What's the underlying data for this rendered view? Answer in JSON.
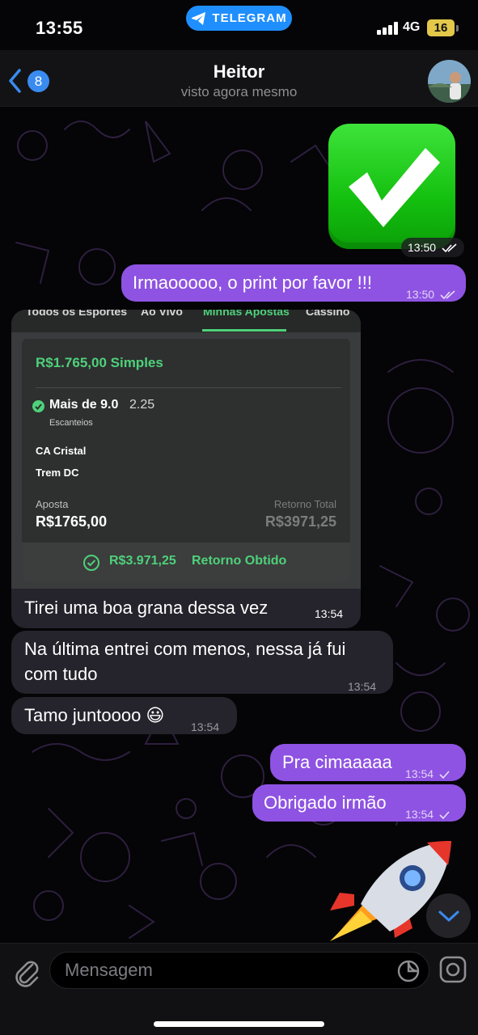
{
  "status_bar": {
    "time": "13:55",
    "app_pill": "TELEGRAM",
    "network": "4G",
    "battery": "16"
  },
  "header": {
    "back_badge": "8",
    "title": "Heitor",
    "subtitle": "visto agora mesmo"
  },
  "messages": {
    "emoji_time": "13:50",
    "m1": {
      "text": "Irmaooooo, o print por favor !!!",
      "time": "13:50"
    },
    "bet": {
      "tabs": [
        "Todos os Esportes",
        "Ao Vivo",
        "Minhas Apostas",
        "Cassino"
      ],
      "title": "R$1.765,00 Simples",
      "market": "Mais de 9.0",
      "odds": "2.25",
      "market_sub": "Escanteios",
      "team1": "CA Cristal",
      "team2": "Trem DC",
      "stake_label": "Aposta",
      "stake_value": "R$1765,00",
      "return_label": "Retorno Total",
      "return_value": "R$3971,25",
      "footer_amount": "R$3.971,25",
      "footer_label": "Retorno Obtido"
    },
    "m2": {
      "text": "Tirei uma boa grana dessa vez",
      "time": "13:54"
    },
    "m3": {
      "line1": "Na última entrei com menos, nessa já fui",
      "line2": "com tudo",
      "time": "13:54"
    },
    "m4": {
      "text": "Tamo juntoooo 😃",
      "time": "13:54"
    },
    "m5": {
      "text": "Pra cimaaaaa",
      "time": "13:54"
    },
    "m6": {
      "text": "Obrigado irmão",
      "time": "13:54"
    }
  },
  "composer": {
    "placeholder": "Mensagem"
  },
  "colors": {
    "outgoing_bubble": "#8e53e2",
    "incoming_bubble": "#25232b",
    "accent_green": "#4ed17a",
    "telegram_blue": "#1f8fff"
  },
  "icons": [
    "back-chevron-icon",
    "telegram-icon",
    "signal-icon",
    "check-mark-emoji",
    "double-check-icon",
    "single-check-icon",
    "rocket-emoji",
    "chevron-down-icon",
    "paperclip-icon",
    "sticker-icon",
    "camera-icon"
  ]
}
